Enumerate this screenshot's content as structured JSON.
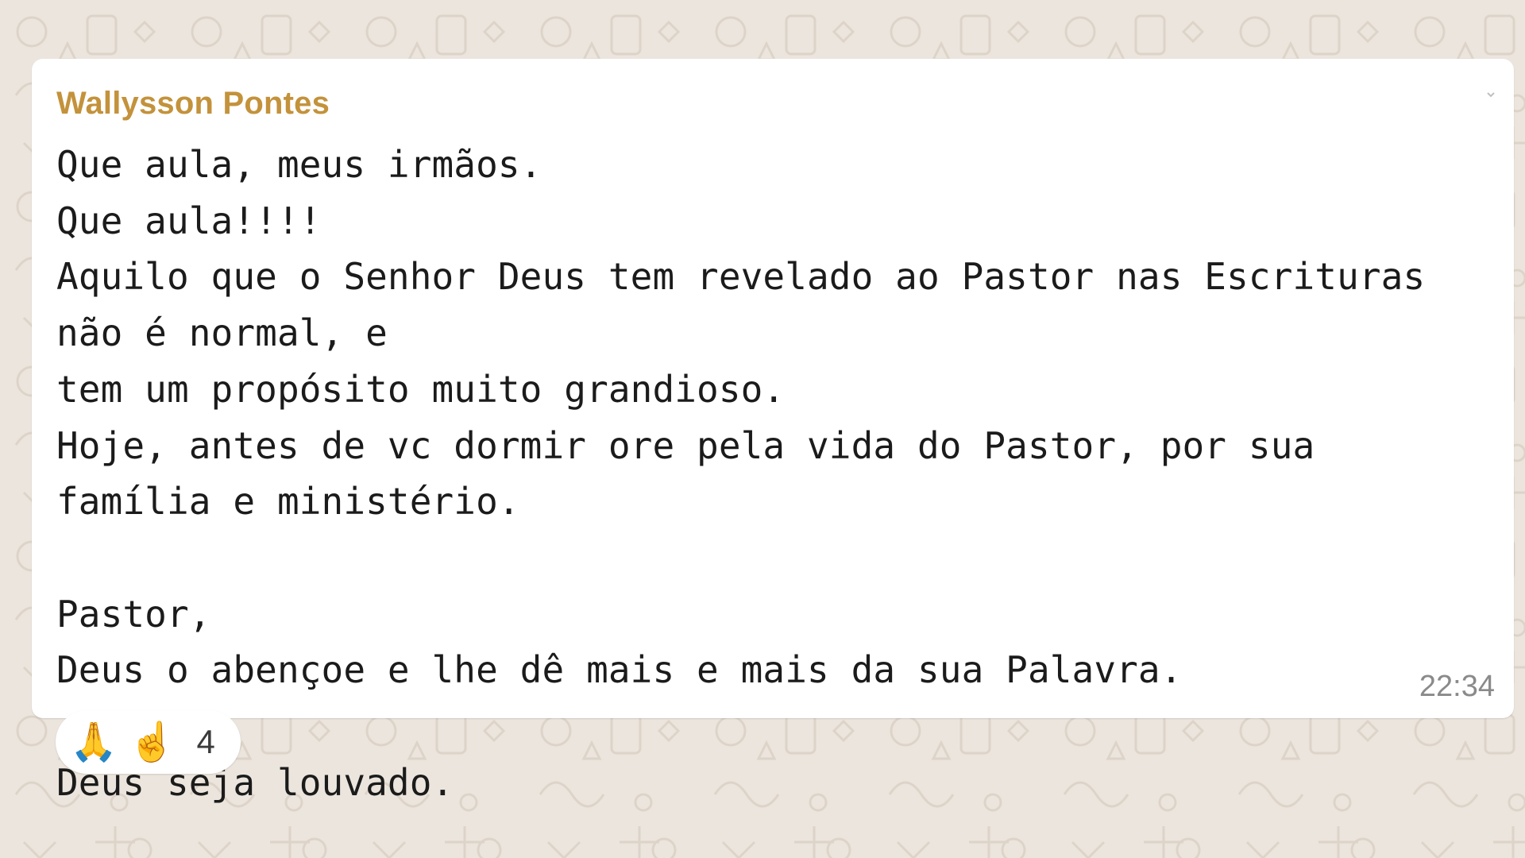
{
  "message": {
    "sender": "Wallysson Pontes",
    "lines": [
      "Que aula, meus irmãos.",
      "Que aula!!!!",
      "Aquilo que o Senhor Deus tem revelado ao Pastor nas Escrituras não é normal, e",
      "tem um propósito muito grandioso.",
      "Hoje, antes de vc dormir ore pela vida do Pastor, por sua família e ministério.",
      "",
      "Pastor,",
      "Deus o abençoe e lhe dê mais e mais da sua Palavra.",
      "",
      "Deus seja louvado."
    ],
    "time": "22:34"
  },
  "reactions": {
    "emojis": [
      "🙏",
      "☝️"
    ],
    "count": "4"
  },
  "icons": {
    "menu": "chevron-down-icon",
    "wallpaper": "doodle-pattern"
  },
  "colors": {
    "background": "#ece5dd",
    "bubble": "#ffffff",
    "sender": "#c3923b",
    "text": "#1b1b1b",
    "time": "#8a8a8a"
  }
}
